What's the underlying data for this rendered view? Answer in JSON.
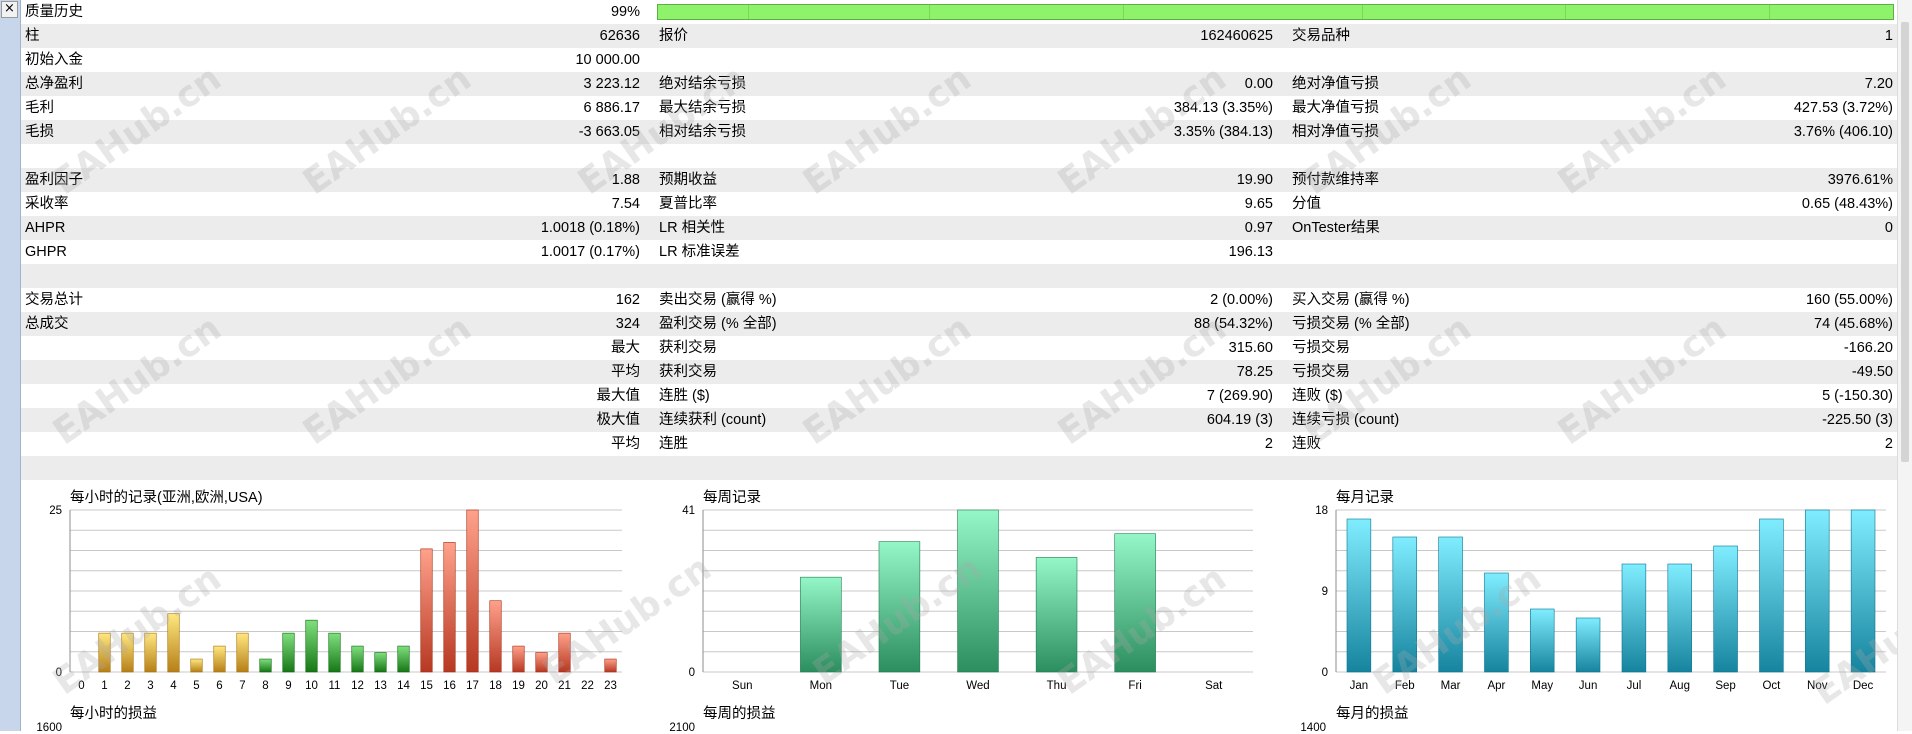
{
  "window": {
    "close_glyph": "×"
  },
  "report_rows": [
    [
      "质量历史",
      "99%",
      "",
      "",
      "",
      ""
    ],
    [
      "柱",
      "62636",
      "报价",
      "162460625",
      "交易品种",
      "1"
    ],
    [
      "初始入金",
      "10 000.00",
      "",
      "",
      "",
      ""
    ],
    [
      "总净盈利",
      "3 223.12",
      "绝对结余亏损",
      "0.00",
      "绝对净值亏损",
      "7.20"
    ],
    [
      "毛利",
      "6 886.17",
      "最大结余亏损",
      "384.13 (3.35%)",
      "最大净值亏损",
      "427.53 (3.72%)"
    ],
    [
      "毛损",
      "-3 663.05",
      "相对结余亏损",
      "3.35% (384.13)",
      "相对净值亏损",
      "3.76% (406.10)"
    ],
    [
      "",
      "",
      "",
      "",
      "",
      ""
    ],
    [
      "盈利因子",
      "1.88",
      "预期收益",
      "19.90",
      "预付款维持率",
      "3976.61%"
    ],
    [
      "采收率",
      "7.54",
      "夏普比率",
      "9.65",
      "分值",
      "0.65 (48.43%)"
    ],
    [
      "AHPR",
      "1.0018 (0.18%)",
      "LR 相关性",
      "0.97",
      "OnTester结果",
      "0"
    ],
    [
      "GHPR",
      "1.0017 (0.17%)",
      "LR 标准误差",
      "196.13",
      "",
      ""
    ],
    [
      "",
      "",
      "",
      "",
      "",
      ""
    ],
    [
      "交易总计",
      "162",
      "卖出交易 (赢得 %)",
      "2 (0.00%)",
      "买入交易 (赢得 %)",
      "160 (55.00%)"
    ],
    [
      "总成交",
      "324",
      "盈利交易 (% 全部)",
      "88 (54.32%)",
      "亏损交易 (% 全部)",
      "74 (45.68%)"
    ],
    [
      "",
      "最大",
      "获利交易",
      "315.60",
      "亏损交易",
      "-166.20"
    ],
    [
      "",
      "平均",
      "获利交易",
      "78.25",
      "亏损交易",
      "-49.50"
    ],
    [
      "",
      "最大值",
      "连胜 ($)",
      "7 (269.90)",
      "连败 ($)",
      "5 (-150.30)"
    ],
    [
      "",
      "极大值",
      "连续获利 (count)",
      "604.19 (3)",
      "连续亏损 (count)",
      "-225.50 (3)"
    ],
    [
      "",
      "平均",
      "连胜",
      "2",
      "连败",
      "2"
    ],
    [
      "",
      "",
      "",
      "",
      "",
      ""
    ]
  ],
  "quality_fill": 0.99,
  "chart_data": [
    {
      "type": "bar",
      "title": "每小时的记录(亚洲,欧洲,USA)",
      "categories": [
        "0",
        "1",
        "2",
        "3",
        "4",
        "5",
        "6",
        "7",
        "8",
        "9",
        "10",
        "11",
        "12",
        "13",
        "14",
        "15",
        "16",
        "17",
        "18",
        "19",
        "20",
        "21",
        "22",
        "23"
      ],
      "values": [
        0,
        6,
        6,
        6,
        9,
        2,
        4,
        6,
        2,
        6,
        8,
        6,
        4,
        3,
        4,
        19,
        20,
        25,
        11,
        4,
        3,
        6,
        0,
        2
      ],
      "colors": [
        "#d9a23a",
        "#d9a23a",
        "#d9a23a",
        "#d9a23a",
        "#d9a23a",
        "#d9a23a",
        "#d9a23a",
        "#d9a23a",
        "#3a9a3a",
        "#3a9a3a",
        "#3a9a3a",
        "#3a9a3a",
        "#3a9a3a",
        "#3a9a3a",
        "#3a9a3a",
        "#d95b45",
        "#d95b45",
        "#d95b45",
        "#d95b45",
        "#d95b45",
        "#d95b45",
        "#d95b45",
        "#d95b45",
        "#d95b45"
      ],
      "ylim": [
        0,
        25
      ],
      "ytick_labels": [
        "25",
        "0"
      ],
      "grid": true
    },
    {
      "type": "bar",
      "title": "每周记录",
      "categories": [
        "Sun",
        "Mon",
        "Tue",
        "Wed",
        "Thu",
        "Fri",
        "Sat"
      ],
      "values": [
        0,
        24,
        33,
        41,
        29,
        35,
        0
      ],
      "colors": [
        "#4fb081",
        "#4fb081",
        "#4fb081",
        "#4fb081",
        "#4fb081",
        "#4fb081",
        "#4fb081"
      ],
      "ylim": [
        0,
        41
      ],
      "ytick_labels": [
        "41",
        "0"
      ],
      "grid": true
    },
    {
      "type": "bar",
      "title": "每月记录",
      "categories": [
        "Jan",
        "Feb",
        "Mar",
        "Apr",
        "May",
        "Jun",
        "Jul",
        "Aug",
        "Sep",
        "Oct",
        "Nov",
        "Dec"
      ],
      "values": [
        17,
        15,
        15,
        11,
        7,
        6,
        12,
        12,
        14,
        17,
        18,
        18
      ],
      "colors": [
        "#3aa7c2",
        "#3aa7c2",
        "#3aa7c2",
        "#3aa7c2",
        "#3aa7c2",
        "#3aa7c2",
        "#3aa7c2",
        "#3aa7c2",
        "#3aa7c2",
        "#3aa7c2",
        "#3aa7c2",
        "#3aa7c2"
      ],
      "ylim": [
        0,
        18
      ],
      "ytick_labels": [
        "18",
        "9",
        "0"
      ],
      "grid": true
    }
  ],
  "bottom_titles": [
    "每小时的损益",
    "每周的损益",
    "每月的损益"
  ],
  "bottom_ylabels": [
    "1600",
    "2100",
    "1400"
  ],
  "watermark": "EAHub.cn"
}
